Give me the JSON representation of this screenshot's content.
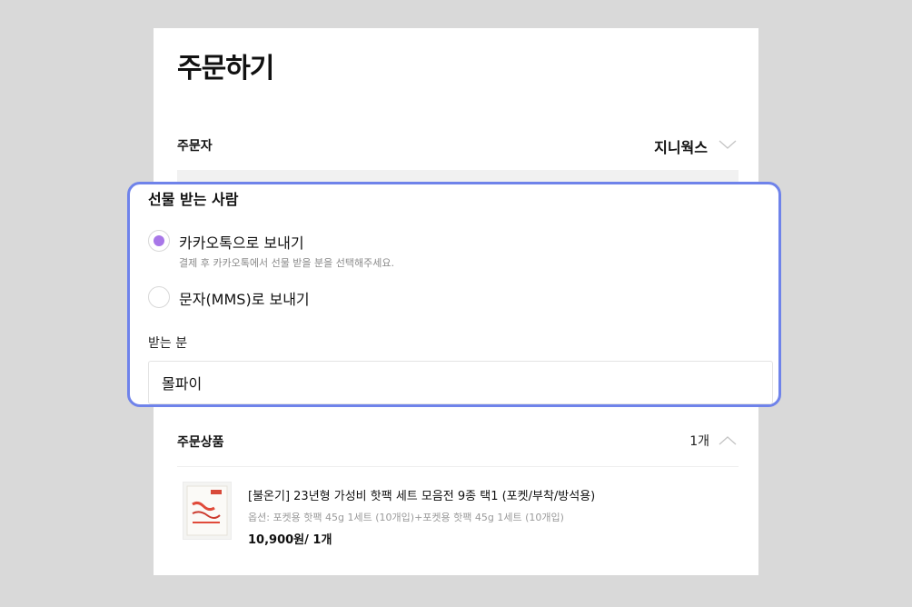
{
  "page": {
    "title": "주문하기"
  },
  "orderer": {
    "label": "주문자",
    "value": "지니웍스"
  },
  "recipient": {
    "section_title": "선물 받는 사람",
    "options": [
      {
        "label": "카카오톡으로 보내기",
        "description": "결제 후 카카오톡에서 선물 받을 분을 선택해주세요.",
        "selected": true
      },
      {
        "label": "문자(MMS)로 보내기",
        "selected": false
      }
    ],
    "name_label": "받는 분",
    "name_value": "몰파이"
  },
  "products": {
    "label": "주문상품",
    "count": "1개",
    "items": [
      {
        "name": "[불온기] 23년형 가성비 핫팩 세트 모음전 9종 택1 (포켓/부착/방석용)",
        "option": "옵션: 포켓용 핫팩 45g 1세트 (10개입)+포켓용 핫팩 45g 1세트 (10개입)",
        "price": "10,900원/ 1개"
      }
    ]
  },
  "colors": {
    "accent": "#a877e8",
    "highlight_border": "#6f83ea",
    "background": "#d9d9d9"
  }
}
